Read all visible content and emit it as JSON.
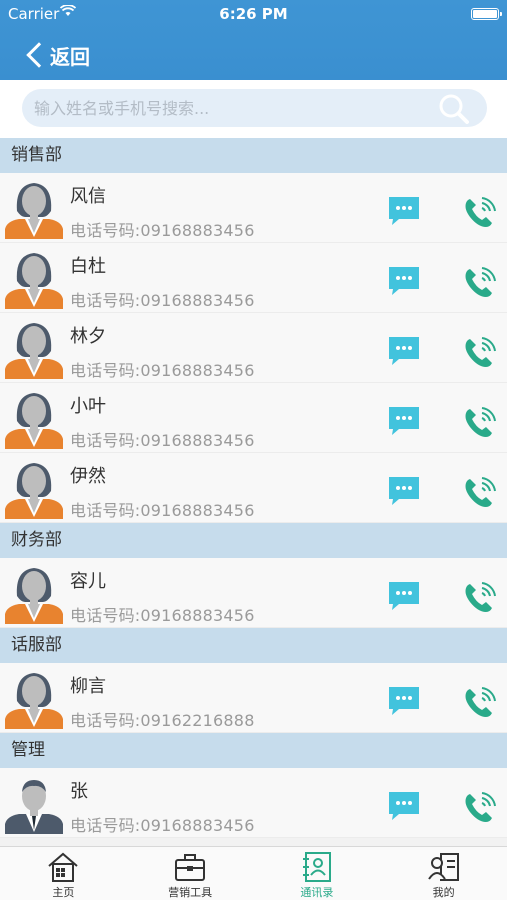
{
  "status": {
    "carrier": "Carrier",
    "time": "6:26 PM"
  },
  "nav": {
    "back_label": "返回"
  },
  "search": {
    "placeholder": "输入姓名或手机号搜索..."
  },
  "colors": {
    "accent": "#3a8fd0",
    "section_bg": "#c6dcec",
    "message": "#41c3dd",
    "call": "#2aaa8a"
  },
  "sections": [
    {
      "title": "销售部",
      "contacts": [
        {
          "name": "风信",
          "phone": "电话号码:09168883456",
          "avatar": "female"
        },
        {
          "name": "白杜",
          "phone": "电话号码:09168883456",
          "avatar": "female"
        },
        {
          "name": "林夕",
          "phone": "电话号码:09168883456",
          "avatar": "female"
        },
        {
          "name": "小叶",
          "phone": "电话号码:09168883456",
          "avatar": "female"
        },
        {
          "name": "伊然",
          "phone": "电话号码:09168883456",
          "avatar": "female"
        }
      ]
    },
    {
      "title": "财务部",
      "contacts": [
        {
          "name": "容儿",
          "phone": "电话号码:09168883456",
          "avatar": "female"
        }
      ]
    },
    {
      "title": "话服部",
      "contacts": [
        {
          "name": "柳言",
          "phone": "电话号码:09162216888",
          "avatar": "female"
        }
      ]
    },
    {
      "title": "管理",
      "contacts": [
        {
          "name": "张",
          "phone": "电话号码:09168883456",
          "avatar": "male"
        }
      ]
    }
  ],
  "tabs": [
    {
      "label": "主页",
      "icon": "home-icon"
    },
    {
      "label": "营销工具",
      "icon": "briefcase-icon"
    },
    {
      "label": "通讯录",
      "icon": "contacts-icon",
      "active": true
    },
    {
      "label": "我的",
      "icon": "profile-icon"
    }
  ]
}
